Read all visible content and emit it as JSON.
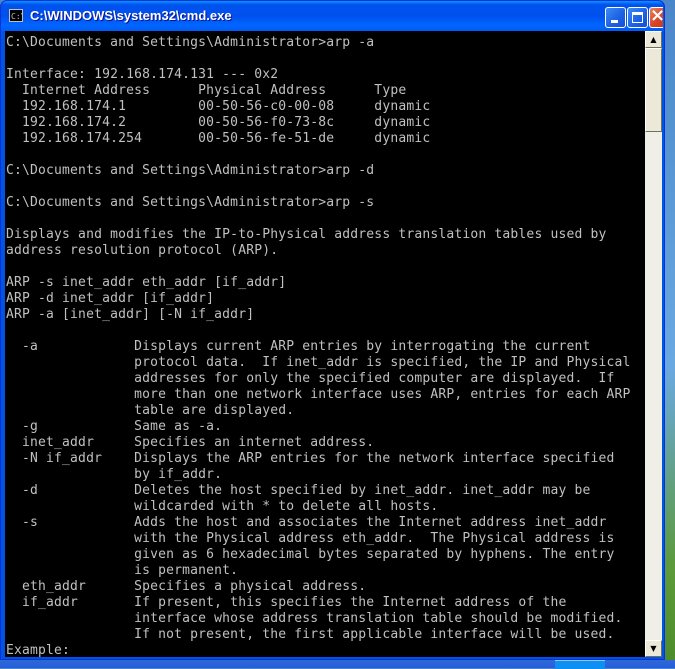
{
  "window": {
    "title": "C:\\WINDOWS\\system32\\cmd.exe",
    "app_icon_label": "C:\\"
  },
  "console": {
    "lines": [
      "C:\\Documents and Settings\\Administrator>arp -a",
      "",
      "Interface: 192.168.174.131 --- 0x2",
      "  Internet Address      Physical Address      Type",
      "  192.168.174.1         00-50-56-c0-00-08     dynamic",
      "  192.168.174.2         00-50-56-f0-73-8c     dynamic",
      "  192.168.174.254       00-50-56-fe-51-de     dynamic",
      "",
      "C:\\Documents and Settings\\Administrator>arp -d",
      "",
      "C:\\Documents and Settings\\Administrator>arp -s",
      "",
      "Displays and modifies the IP-to-Physical address translation tables used by",
      "address resolution protocol (ARP).",
      "",
      "ARP -s inet_addr eth_addr [if_addr]",
      "ARP -d inet_addr [if_addr]",
      "ARP -a [inet_addr] [-N if_addr]",
      "",
      "  -a            Displays current ARP entries by interrogating the current",
      "                protocol data.  If inet_addr is specified, the IP and Physical",
      "                addresses for only the specified computer are displayed.  If",
      "                more than one network interface uses ARP, entries for each ARP",
      "                table are displayed.",
      "  -g            Same as -a.",
      "  inet_addr     Specifies an internet address.",
      "  -N if_addr    Displays the ARP entries for the network interface specified",
      "                by if_addr.",
      "  -d            Deletes the host specified by inet_addr. inet_addr may be",
      "                wildcarded with * to delete all hosts.",
      "  -s            Adds the host and associates the Internet address inet_addr",
      "                with the Physical address eth_addr.  The Physical address is",
      "                given as 6 hexadecimal bytes separated by hyphens. The entry",
      "                is permanent.",
      "  eth_addr      Specifies a physical address.",
      "  if_addr       If present, this specifies the Internet address of the",
      "                interface whose address translation table should be modified.",
      "                If not present, the first applicable interface will be used.",
      "Example:"
    ]
  },
  "scrollbar": {
    "up_glyph": "▲",
    "down_glyph": "▼"
  },
  "colors": {
    "console_bg": "#000000",
    "console_text": "#c0c0c0",
    "titlebar": "#0054e3"
  }
}
